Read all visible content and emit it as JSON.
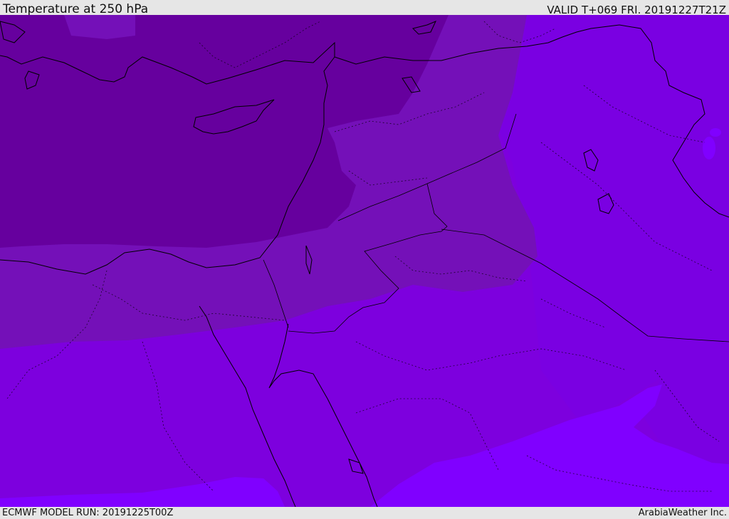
{
  "header": {
    "title": "Temperature at 250 hPa",
    "valid": "VALID T+069 FRI. 20191227T21Z"
  },
  "footer": {
    "model_run": "ECMWF MODEL RUN: 20191225T00Z",
    "credit": "ArabiaWeather Inc."
  },
  "map": {
    "colors": {
      "coldest": "#66009e",
      "cold": "#7410b8",
      "mid": "#7d00de",
      "warm": "#8000ff",
      "coastline": "#000000"
    }
  }
}
